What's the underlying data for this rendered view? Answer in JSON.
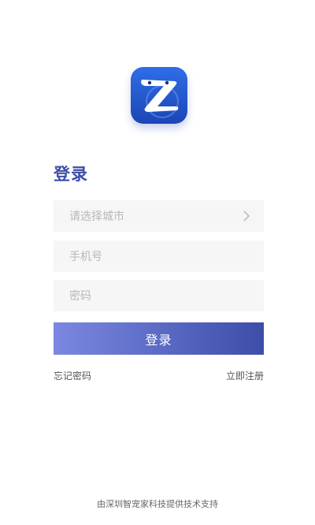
{
  "app": {
    "logo_icon": "z-logo-icon",
    "brand_color": "#1b46b6"
  },
  "login": {
    "title": "登录",
    "city_placeholder": "请选择城市",
    "phone_placeholder": "手机号",
    "password_placeholder": "密码",
    "submit_label": "登录",
    "forgot_password": "忘记密码",
    "register": "立即注册",
    "accent_color": "#3d4ea8"
  },
  "footer": {
    "text": "由深圳智宠家科技提供技术支持"
  }
}
